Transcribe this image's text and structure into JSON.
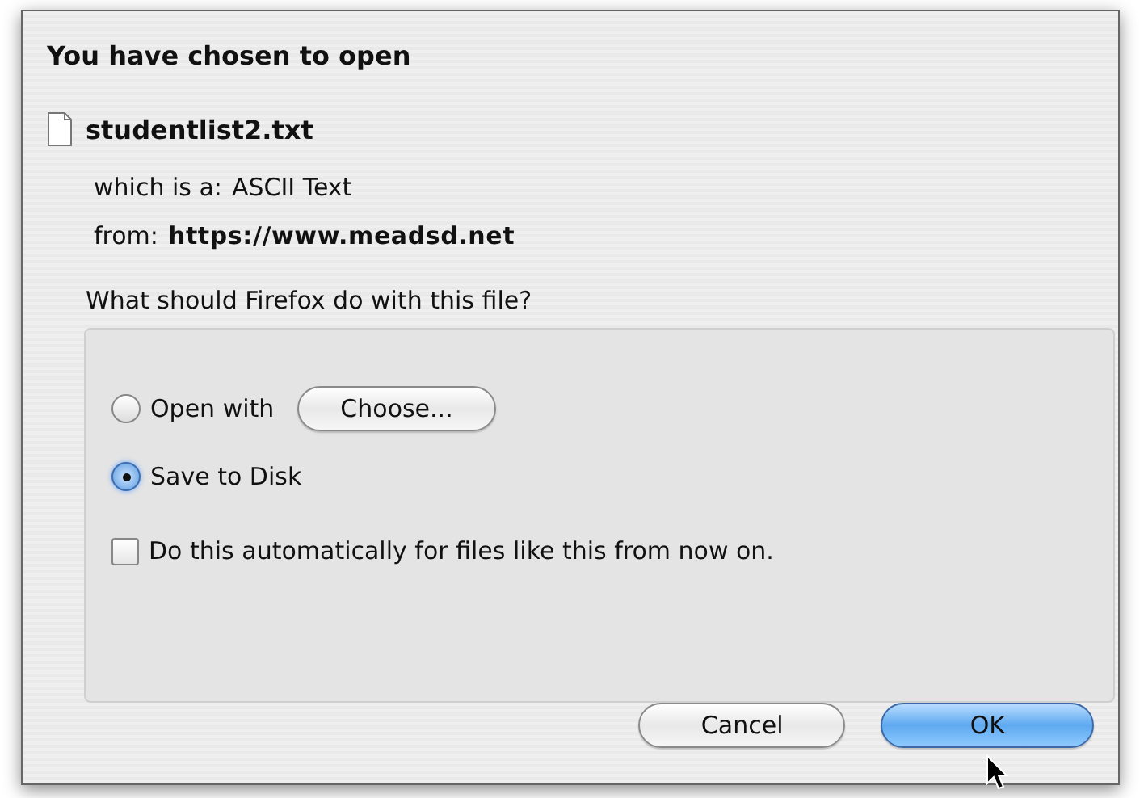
{
  "dialog": {
    "heading": "You have chosen to open",
    "file_name": "studentlist2.txt",
    "file_type_label": "which is a:",
    "file_type": "ASCII Text",
    "source_label": "from:",
    "source": "https://www.meadsd.net"
  },
  "question": "What should Firefox do with this file?",
  "options": [
    {
      "kind": "radio",
      "label": "Open with",
      "selected": false,
      "button": "Choose..."
    },
    {
      "kind": "radio",
      "label": "Save to Disk",
      "selected": true
    },
    {
      "kind": "checkbox",
      "label": "Do this automatically for files like this from now on.",
      "checked": false
    }
  ],
  "buttons": [
    {
      "label": "Cancel",
      "default": false
    },
    {
      "label": "OK",
      "default": true
    }
  ]
}
